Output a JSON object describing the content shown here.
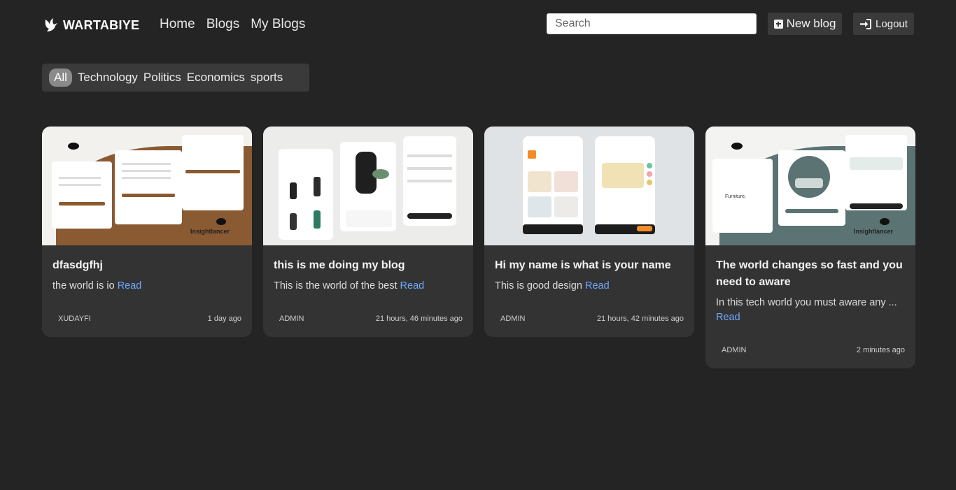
{
  "brand": {
    "name": "WARTABIYE"
  },
  "nav": {
    "links": [
      {
        "label": "Home"
      },
      {
        "label": "Blogs"
      },
      {
        "label": "My Blogs"
      }
    ]
  },
  "search": {
    "placeholder": "Search",
    "value": ""
  },
  "actions": {
    "new_blog": "New blog",
    "logout": "Logout"
  },
  "categories": {
    "items": [
      {
        "label": "All",
        "active": true
      },
      {
        "label": "Technology"
      },
      {
        "label": "Politics"
      },
      {
        "label": "Economics"
      },
      {
        "label": "sports"
      }
    ]
  },
  "posts": [
    {
      "title": "dfasdgfhj",
      "excerpt": "the world is io",
      "read": "Read",
      "author": "XUDAYFI",
      "time": "1 day ago",
      "thumb_text": "Insightlancer"
    },
    {
      "title": "this is me doing my blog",
      "excerpt": "This is the world of the best",
      "read": "Read",
      "author": "ADMIN",
      "time": "21 hours, 46 minutes ago"
    },
    {
      "title": "Hi my name is what is your name",
      "excerpt": "This is good design",
      "read": "Read",
      "author": "ADMIN",
      "time": "21 hours, 42 minutes ago"
    },
    {
      "title": "The world changes so fast and you need to aware",
      "excerpt": "In this tech world you must aware any ...",
      "read": "Read",
      "author": "ADMIN",
      "time": "2 minutes ago",
      "thumb_text": "Insightlancer"
    }
  ],
  "colors": {
    "background": "#242424",
    "card": "#333333",
    "link": "#6ea8fe"
  }
}
